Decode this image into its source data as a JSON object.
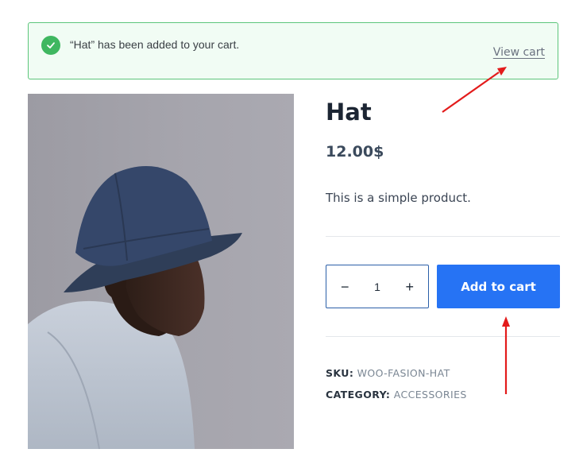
{
  "notice": {
    "message": "“Hat” has been added to your cart.",
    "view_cart_label": "View cart",
    "icon": "check-circle-icon",
    "accent": "#3fb760"
  },
  "product": {
    "image_alt": "Man wearing a navy bucket hat",
    "title": "Hat",
    "price": "12.00$",
    "description": "This is a simple product.",
    "quantity": "1",
    "add_to_cart_label": "Add to cart",
    "meta": {
      "sku_label": "SKU:",
      "sku_value": "WOO-FASION-HAT",
      "category_label": "CATEGORY:",
      "category_value": "ACCESSORIES"
    }
  },
  "colors": {
    "button": "#2673f4",
    "annotation_arrow": "#e31b1b"
  }
}
